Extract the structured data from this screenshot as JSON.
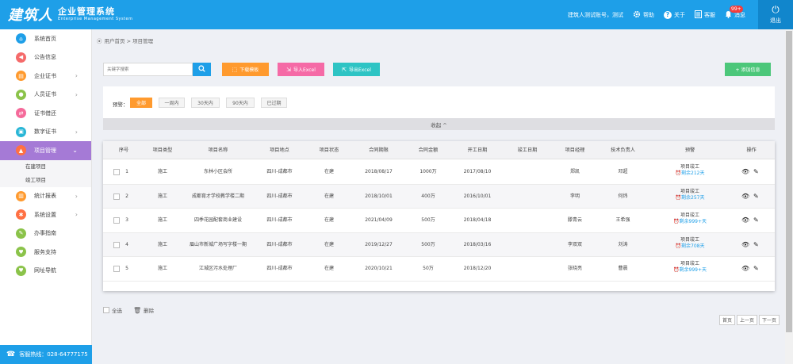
{
  "header": {
    "logo_main": "建筑人",
    "logo_title": "企业管理系统",
    "logo_sub": "Enterprise Management System",
    "account": "建筑人测试账号，测试",
    "help": "帮助",
    "about": "关于",
    "service": "客服",
    "messages": "消息",
    "message_badge": "99+",
    "logout": "退出"
  },
  "sidebar": {
    "items": [
      {
        "label": "系统首页",
        "icon": "home-icon",
        "color": "#1e9fe8"
      },
      {
        "label": "公告信息",
        "icon": "speaker-icon",
        "color": "#f56a6a"
      },
      {
        "label": "企业证书",
        "icon": "certificate-icon",
        "color": "#ff9a2e"
      },
      {
        "label": "人员证书",
        "icon": "person-icon",
        "color": "#8bc34a"
      },
      {
        "label": "证书借还",
        "icon": "exchange-icon",
        "color": "#f56a9a"
      },
      {
        "label": "数字证书",
        "icon": "digital-cert-icon",
        "color": "#29b6d6"
      },
      {
        "label": "项目管理",
        "icon": "project-icon",
        "color": "#ff7043"
      },
      {
        "label": "统计报表",
        "icon": "report-icon",
        "color": "#ff9a2e"
      },
      {
        "label": "系统设置",
        "icon": "settings-icon",
        "color": "#ff7043"
      },
      {
        "label": "办事指南",
        "icon": "guide-icon",
        "color": "#8bc34a"
      },
      {
        "label": "服务支持",
        "icon": "support-icon",
        "color": "#8bc34a"
      },
      {
        "label": "网址导航",
        "icon": "nav-icon",
        "color": "#8bc34a"
      }
    ],
    "subitems": [
      "在建项目",
      "竣工项目"
    ],
    "hotline": "客服热线：028-64777175"
  },
  "breadcrumb": "用户首页 > 项目管理",
  "toolbar": {
    "search_placeholder": "关键字搜索",
    "download_template": "下载模板",
    "import_excel": "导入Excel",
    "export_excel": "导出Excel",
    "add_info": "+ 添加信息"
  },
  "filter": {
    "label": "预警：",
    "chips": [
      "全部",
      "一周内",
      "30天内",
      "90天内",
      "已过期"
    ],
    "selected": "全部",
    "collapse": "收起 ^"
  },
  "table": {
    "columns": [
      "序号",
      "项目类型",
      "项目名称",
      "项目地点",
      "项目状态",
      "合同期限",
      "合同金额",
      "开工日期",
      "竣工日期",
      "项目经理",
      "技术负责人",
      "预警",
      "操作"
    ],
    "rows": [
      {
        "no": "1",
        "type": "施工",
        "name": "东林小区会所",
        "place": "四川-成都市",
        "status": "在建",
        "term": "2018/08/17",
        "amount": "1000万",
        "start": "2017/08/10",
        "finish": "",
        "manager": "郑凯",
        "tech": "邓超",
        "warn_title": "项目竣工",
        "warn_remain": "剩余212天"
      },
      {
        "no": "2",
        "type": "施工",
        "name": "成都育才学校教学楼二期",
        "place": "四川-成都市",
        "status": "在建",
        "term": "2018/10/01",
        "amount": "400万",
        "start": "2016/10/01",
        "finish": "",
        "manager": "李明",
        "tech": "何炜",
        "warn_title": "项目竣工",
        "warn_remain": "剩余257天"
      },
      {
        "no": "3",
        "type": "施工",
        "name": "四季花园配套商业建设",
        "place": "四川-成都市",
        "status": "在建",
        "term": "2021/04/09",
        "amount": "500万",
        "start": "2018/04/18",
        "finish": "",
        "manager": "滕青云",
        "tech": "王希强",
        "warn_title": "项目竣工",
        "warn_remain": "剩余999+天"
      },
      {
        "no": "4",
        "type": "施工",
        "name": "眉山市新城广场写字楼一期",
        "place": "四川-成都市",
        "status": "在建",
        "term": "2019/12/27",
        "amount": "500万",
        "start": "2018/03/16",
        "finish": "",
        "manager": "李双双",
        "tech": "刘涛",
        "warn_title": "项目竣工",
        "warn_remain": "剩余708天"
      },
      {
        "no": "5",
        "type": "施工",
        "name": "江城区污水处理厂",
        "place": "四川-成都市",
        "status": "在建",
        "term": "2020/10/21",
        "amount": "50万",
        "start": "2018/12/20",
        "finish": "",
        "manager": "张晓亮",
        "tech": "曹晨",
        "warn_title": "项目竣工",
        "warn_remain": "剩余999+天"
      }
    ]
  },
  "footer": {
    "select_all": "全选",
    "delete": "删除"
  },
  "pager": {
    "first": "首页",
    "prev": "上一页",
    "next": "下一页"
  }
}
